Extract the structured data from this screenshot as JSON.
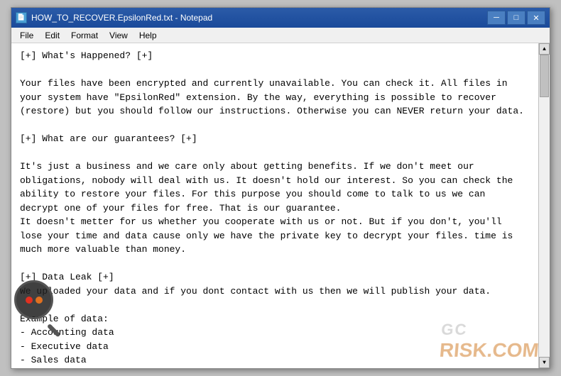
{
  "window": {
    "title": "HOW_TO_RECOVER.EpsilonRed.txt - Notepad",
    "title_icon": "📄"
  },
  "title_buttons": {
    "minimize": "─",
    "maximize": "□",
    "close": "✕"
  },
  "menu": {
    "items": [
      "File",
      "Edit",
      "Format",
      "View",
      "Help"
    ]
  },
  "content": {
    "text": "[+] What's Happened? [+]\n\nYour files have been encrypted and currently unavailable. You can check it. All files in\nyour system have \"EpsilonRed\" extension. By the way, everything is possible to recover\n(restore) but you should follow our instructions. Otherwise you can NEVER return your data.\n\n[+] What are our guarantees? [+]\n\nIt's just a business and we care only about getting benefits. If we don't meet our\nobligations, nobody will deal with us. It doesn't hold our interest. So you can check the\nability to restore your files. For this purpose you should come to talk to us we can\ndecrypt one of your files for free. That is our guarantee.\nIt doesn't metter for us whether you cooperate with us or not. But if you don't, you'll\nlose your time and data cause only we have the private key to decrypt your files. time is\nmuch more valuable than money.\n\n[+] Data Leak [+]\nWe uploaded your data and if you dont contact with us then we will publish your data.\n\nExample of data:\n- Accounting data\n- Executive data\n- Sales data\n- Customer support data\n- Marketing data\n- And more other ..."
  },
  "watermark": {
    "top": "GC",
    "bottom": "RISK.COM"
  }
}
